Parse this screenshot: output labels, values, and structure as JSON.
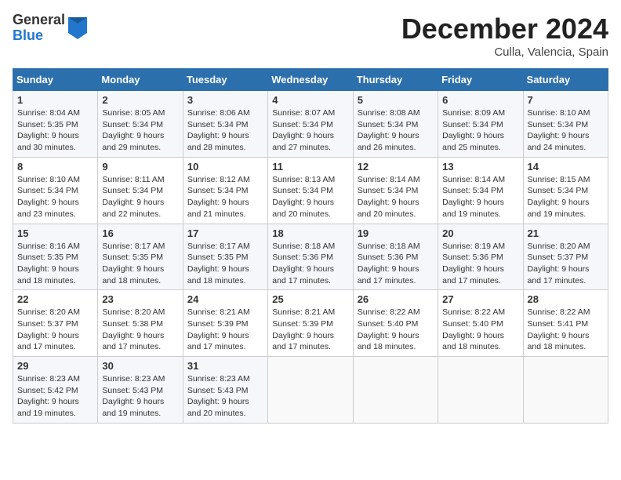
{
  "header": {
    "logo_general": "General",
    "logo_blue": "Blue",
    "month_title": "December 2024",
    "subtitle": "Culla, Valencia, Spain"
  },
  "weekdays": [
    "Sunday",
    "Monday",
    "Tuesday",
    "Wednesday",
    "Thursday",
    "Friday",
    "Saturday"
  ],
  "weeks": [
    [
      {
        "day": "1",
        "sunrise": "8:04 AM",
        "sunset": "5:35 PM",
        "daylight": "9 hours and 30 minutes."
      },
      {
        "day": "2",
        "sunrise": "8:05 AM",
        "sunset": "5:34 PM",
        "daylight": "9 hours and 29 minutes."
      },
      {
        "day": "3",
        "sunrise": "8:06 AM",
        "sunset": "5:34 PM",
        "daylight": "9 hours and 28 minutes."
      },
      {
        "day": "4",
        "sunrise": "8:07 AM",
        "sunset": "5:34 PM",
        "daylight": "9 hours and 27 minutes."
      },
      {
        "day": "5",
        "sunrise": "8:08 AM",
        "sunset": "5:34 PM",
        "daylight": "9 hours and 26 minutes."
      },
      {
        "day": "6",
        "sunrise": "8:09 AM",
        "sunset": "5:34 PM",
        "daylight": "9 hours and 25 minutes."
      },
      {
        "day": "7",
        "sunrise": "8:10 AM",
        "sunset": "5:34 PM",
        "daylight": "9 hours and 24 minutes."
      }
    ],
    [
      {
        "day": "8",
        "sunrise": "8:10 AM",
        "sunset": "5:34 PM",
        "daylight": "9 hours and 23 minutes."
      },
      {
        "day": "9",
        "sunrise": "8:11 AM",
        "sunset": "5:34 PM",
        "daylight": "9 hours and 22 minutes."
      },
      {
        "day": "10",
        "sunrise": "8:12 AM",
        "sunset": "5:34 PM",
        "daylight": "9 hours and 21 minutes."
      },
      {
        "day": "11",
        "sunrise": "8:13 AM",
        "sunset": "5:34 PM",
        "daylight": "9 hours and 20 minutes."
      },
      {
        "day": "12",
        "sunrise": "8:14 AM",
        "sunset": "5:34 PM",
        "daylight": "9 hours and 20 minutes."
      },
      {
        "day": "13",
        "sunrise": "8:14 AM",
        "sunset": "5:34 PM",
        "daylight": "9 hours and 19 minutes."
      },
      {
        "day": "14",
        "sunrise": "8:15 AM",
        "sunset": "5:34 PM",
        "daylight": "9 hours and 19 minutes."
      }
    ],
    [
      {
        "day": "15",
        "sunrise": "8:16 AM",
        "sunset": "5:35 PM",
        "daylight": "9 hours and 18 minutes."
      },
      {
        "day": "16",
        "sunrise": "8:17 AM",
        "sunset": "5:35 PM",
        "daylight": "9 hours and 18 minutes."
      },
      {
        "day": "17",
        "sunrise": "8:17 AM",
        "sunset": "5:35 PM",
        "daylight": "9 hours and 18 minutes."
      },
      {
        "day": "18",
        "sunrise": "8:18 AM",
        "sunset": "5:36 PM",
        "daylight": "9 hours and 17 minutes."
      },
      {
        "day": "19",
        "sunrise": "8:18 AM",
        "sunset": "5:36 PM",
        "daylight": "9 hours and 17 minutes."
      },
      {
        "day": "20",
        "sunrise": "8:19 AM",
        "sunset": "5:36 PM",
        "daylight": "9 hours and 17 minutes."
      },
      {
        "day": "21",
        "sunrise": "8:20 AM",
        "sunset": "5:37 PM",
        "daylight": "9 hours and 17 minutes."
      }
    ],
    [
      {
        "day": "22",
        "sunrise": "8:20 AM",
        "sunset": "5:37 PM",
        "daylight": "9 hours and 17 minutes."
      },
      {
        "day": "23",
        "sunrise": "8:20 AM",
        "sunset": "5:38 PM",
        "daylight": "9 hours and 17 minutes."
      },
      {
        "day": "24",
        "sunrise": "8:21 AM",
        "sunset": "5:39 PM",
        "daylight": "9 hours and 17 minutes."
      },
      {
        "day": "25",
        "sunrise": "8:21 AM",
        "sunset": "5:39 PM",
        "daylight": "9 hours and 17 minutes."
      },
      {
        "day": "26",
        "sunrise": "8:22 AM",
        "sunset": "5:40 PM",
        "daylight": "9 hours and 18 minutes."
      },
      {
        "day": "27",
        "sunrise": "8:22 AM",
        "sunset": "5:40 PM",
        "daylight": "9 hours and 18 minutes."
      },
      {
        "day": "28",
        "sunrise": "8:22 AM",
        "sunset": "5:41 PM",
        "daylight": "9 hours and 18 minutes."
      }
    ],
    [
      {
        "day": "29",
        "sunrise": "8:23 AM",
        "sunset": "5:42 PM",
        "daylight": "9 hours and 19 minutes."
      },
      {
        "day": "30",
        "sunrise": "8:23 AM",
        "sunset": "5:43 PM",
        "daylight": "9 hours and 19 minutes."
      },
      {
        "day": "31",
        "sunrise": "8:23 AM",
        "sunset": "5:43 PM",
        "daylight": "9 hours and 20 minutes."
      },
      null,
      null,
      null,
      null
    ]
  ]
}
